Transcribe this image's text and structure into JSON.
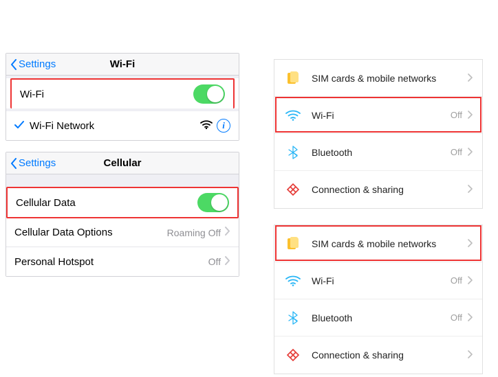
{
  "ios_wifi": {
    "back": "Settings",
    "title": "Wi-Fi",
    "toggle_label": "Wi-Fi",
    "network_name": "Wi-Fi Network"
  },
  "ios_cellular": {
    "back": "Settings",
    "title": "Cellular",
    "data_label": "Cellular Data",
    "options_label": "Cellular Data Options",
    "options_value": "Roaming Off",
    "hotspot_label": "Personal Hotspot",
    "hotspot_value": "Off"
  },
  "android1": {
    "rows": [
      {
        "label": "SIM cards & mobile networks",
        "value": ""
      },
      {
        "label": "Wi-Fi",
        "value": "Off"
      },
      {
        "label": "Bluetooth",
        "value": "Off"
      },
      {
        "label": "Connection & sharing",
        "value": ""
      }
    ]
  },
  "android2": {
    "rows": [
      {
        "label": "SIM cards & mobile networks",
        "value": ""
      },
      {
        "label": "Wi-Fi",
        "value": "Off"
      },
      {
        "label": "Bluetooth",
        "value": "Off"
      },
      {
        "label": "Connection & sharing",
        "value": ""
      }
    ]
  }
}
